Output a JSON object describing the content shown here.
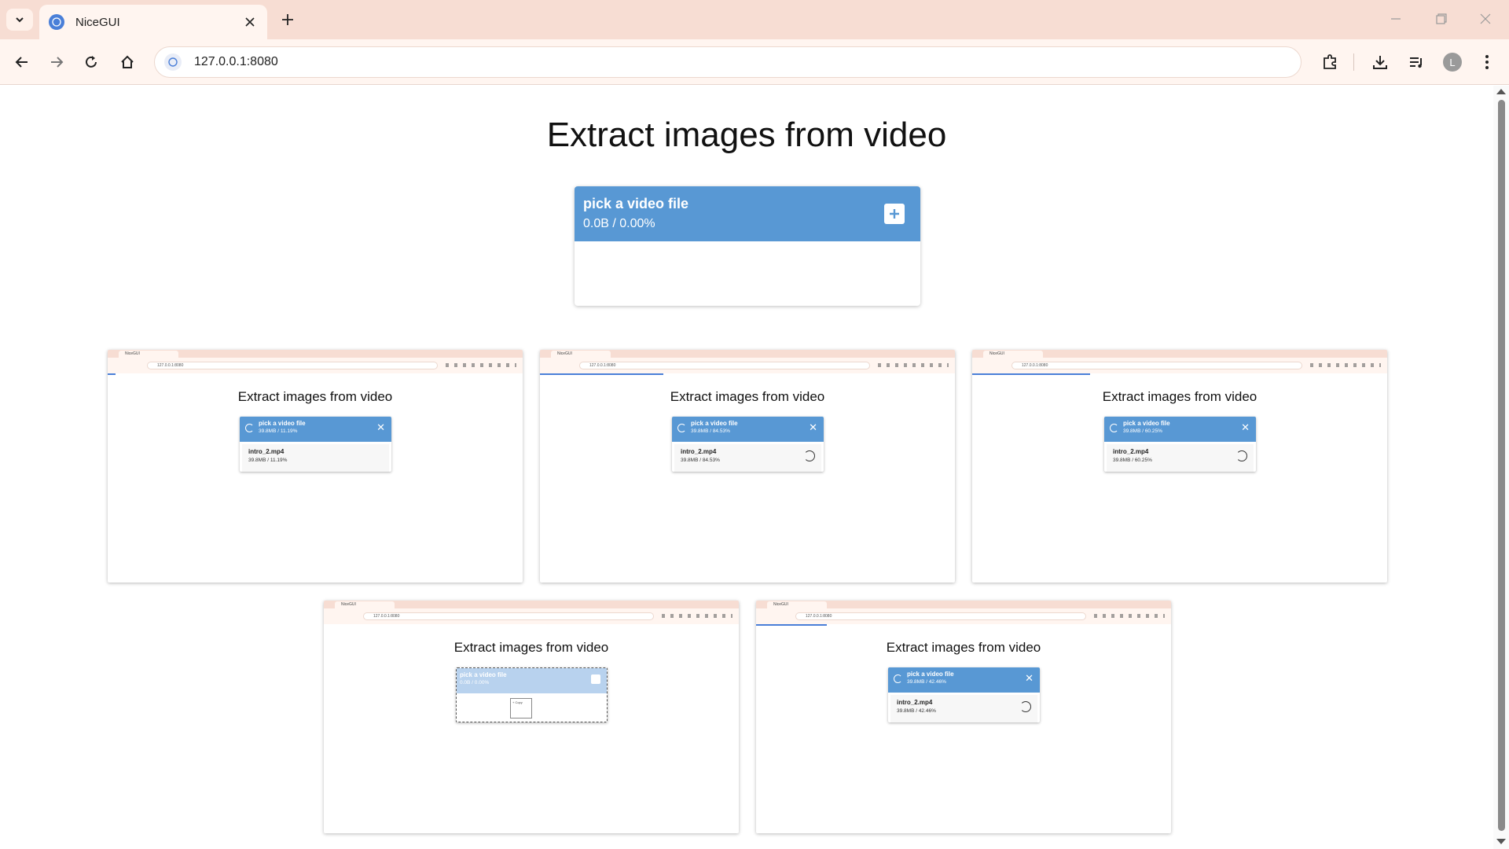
{
  "browser": {
    "tab_title": "NiceGUI",
    "url": "127.0.0.1:8080",
    "profile_initial": "L"
  },
  "page": {
    "title": "Extract images from video",
    "upload": {
      "label": "pick a video file",
      "status": "0.0B / 0.00%"
    }
  },
  "thumbnails": [
    {
      "title": "Extract images from video",
      "tab": "NiceGUI",
      "url": "127.0.0.1:8080",
      "card_label": "pick a video file",
      "card_status": "39.8MB / 11.19%",
      "file_name": "intro_2.mp4",
      "file_status": "39.8MB / 11.19%"
    },
    {
      "title": "Extract images from video",
      "tab": "NiceGUI",
      "url": "127.0.0.1:8080",
      "card_label": "pick a video file",
      "card_status": "39.8MB / 84.53%",
      "file_name": "intro_2.mp4",
      "file_status": "39.8MB / 84.53%"
    },
    {
      "title": "Extract images from video",
      "tab": "NiceGUI",
      "url": "127.0.0.1:8080",
      "card_label": "pick a video file",
      "card_status": "39.8MB / 60.25%",
      "file_name": "intro_2.mp4",
      "file_status": "39.8MB / 60.25%"
    },
    {
      "title": "Extract images from video",
      "tab": "NiceGUI",
      "url": "127.0.0.1:8080",
      "card_label": "pick a video file",
      "card_status": "0.0B / 0.00%",
      "drop_label": "+ Copy"
    },
    {
      "title": "Extract images from video",
      "tab": "NiceGUI",
      "url": "127.0.0.1:8080",
      "card_label": "pick a video file",
      "card_status": "39.8MB / 42.46%",
      "file_name": "intro_2.mp4",
      "file_status": "39.8MB / 42.46%"
    }
  ],
  "colors": {
    "accent": "#5898d4",
    "chrome": "#f7ddd3"
  }
}
